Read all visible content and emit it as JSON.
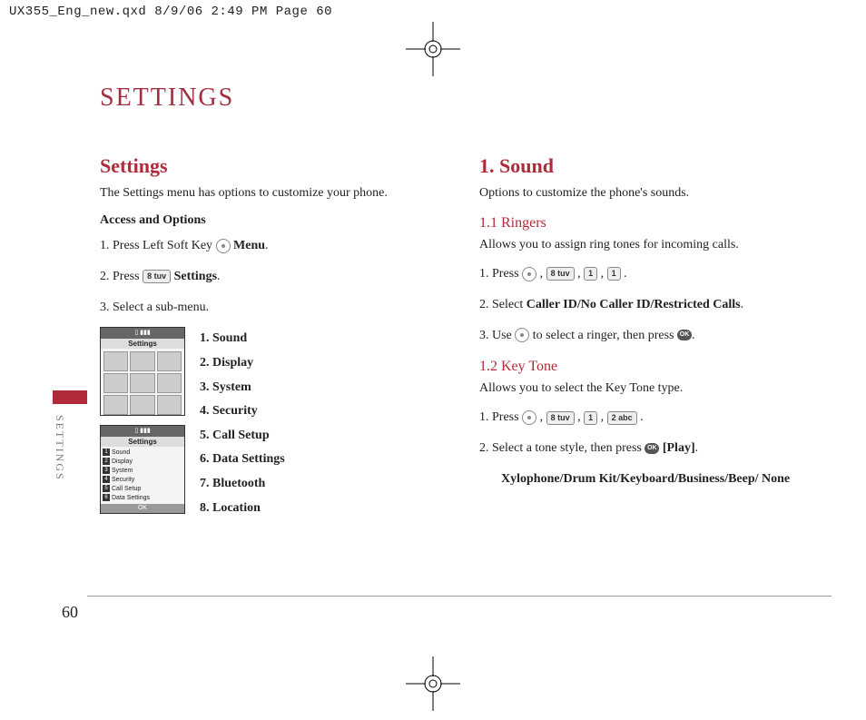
{
  "slug": "UX355_Eng_new.qxd  8/9/06  2:49 PM  Page 60",
  "page_number": "60",
  "side_label": "SETTINGS",
  "header": "SETTINGS",
  "left": {
    "title": "Settings",
    "intro": "The Settings menu has options to customize your phone.",
    "access_heading": "Access and Options",
    "step1_a": "1. Press Left Soft Key ",
    "step1_b": " Menu",
    "step1_dot": ".",
    "step2_a": "2. Press ",
    "step2_key": "8 tuv",
    "step2_b": " Settings",
    "step2_dot": ".",
    "step3": "3. Select a sub-menu.",
    "submenu": [
      "1. Sound",
      "2. Display",
      "3. System",
      "4. Security",
      "5. Call Setup",
      "6. Data Settings",
      "7. Bluetooth",
      "8. Location"
    ],
    "ps_title": "Settings",
    "ps_list": [
      "Sound",
      "Display",
      "System",
      "Security",
      "Call Setup",
      "Data Settings"
    ],
    "ps_ok": "OK"
  },
  "right": {
    "h_sound": "1. Sound",
    "sound_intro": "Options to customize the phone's sounds.",
    "h_ringers": "1.1 Ringers",
    "ringers_intro": "Allows you to assign ring tones for incoming calls.",
    "r_step1_a": "1. Press ",
    "k8": "8 tuv",
    "k1": "1",
    "k1b": "1",
    "r_step2_a": "2. Select ",
    "r_step2_b": "Caller ID/No Caller ID/Restricted Calls",
    "r_step2_dot": ".",
    "r_step3_a": "3. Use ",
    "r_step3_b": " to select a ringer, then press ",
    "r_step3_dot": ".",
    "h_keytone": "1.2 Key Tone",
    "keytone_intro": "Allows you to select the Key Tone type.",
    "kt_step1_a": "1. Press ",
    "k2": "2 abc",
    "kt_step2_a": "2. Select a tone style, then press ",
    "kt_step2_b": " [Play]",
    "kt_step2_dot": ".",
    "tone_options": "Xylophone/Drum Kit/Keyboard/Business/Beep/ None",
    "ok": "OK",
    "comma": " , ",
    "period": " ."
  }
}
